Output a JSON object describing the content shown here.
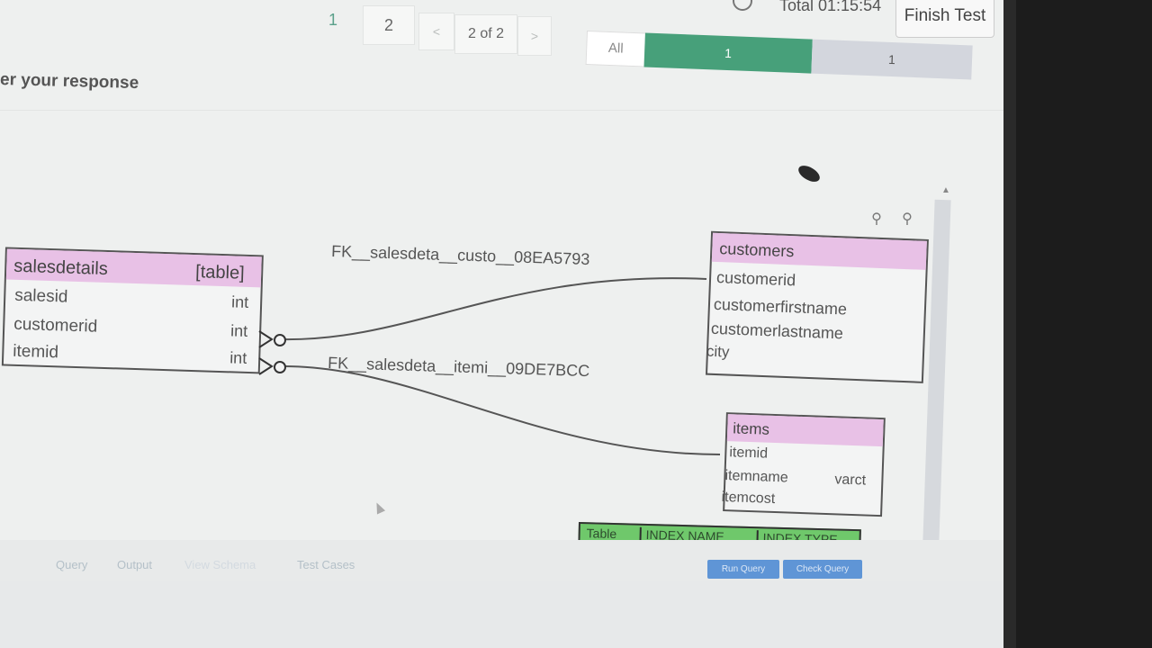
{
  "pagination": {
    "page1": "1",
    "page2": "2",
    "prev": "<",
    "label": "2 of 2",
    "next": ">"
  },
  "timer": {
    "text": "Total 01:15:54"
  },
  "finish_button": "Finish Test",
  "progress": {
    "all": "All",
    "answered": "1",
    "unanswered": "1",
    "answered_color": "#47a07a",
    "unanswered_color": "#d3d6dd"
  },
  "section_label": "er your response",
  "diagram": {
    "fk1": "FK__salesdeta__custo__08EA5793",
    "fk2": "FK__salesdeta__itemi__09DE7BCC",
    "salesdetails": {
      "title": "salesdetails",
      "kind": "[table]",
      "rows": [
        {
          "name": "salesid",
          "type": "int"
        },
        {
          "name": "customerid",
          "type": "int"
        },
        {
          "name": "itemid",
          "type": "int"
        }
      ]
    },
    "customers": {
      "title": "customers",
      "rows": [
        "customerid",
        "customerfirstname",
        "customerlastname",
        "city"
      ]
    },
    "items": {
      "title": "items",
      "rows": [
        {
          "name": "itemid",
          "type": ""
        },
        {
          "name": "itemname",
          "type": "varct"
        },
        {
          "name": "itemcost",
          "type": ""
        }
      ]
    },
    "header_color": "#e8c1e6"
  },
  "index_table": {
    "cols": [
      "Table",
      "INDEX NAME",
      "INDEX TYPE"
    ]
  },
  "bottom_tabs": [
    "Query",
    "Output",
    "View Schema",
    "Test Cases"
  ],
  "buttons": {
    "run": "Run Query",
    "check": "Check Query"
  }
}
